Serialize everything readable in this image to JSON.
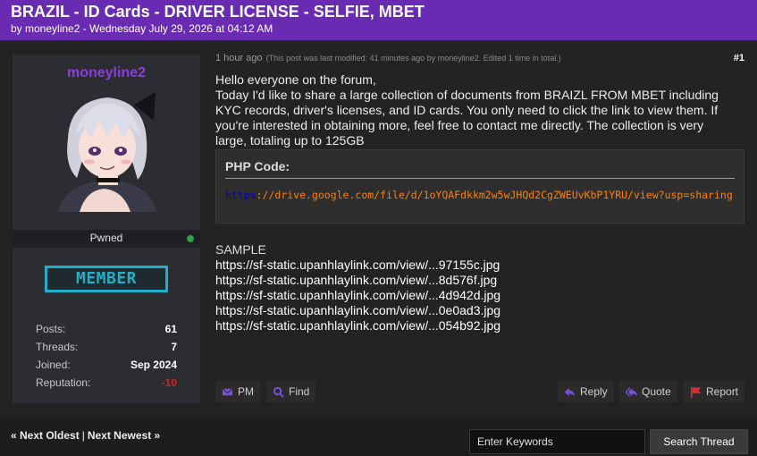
{
  "thread": {
    "title": "BRAZIL - ID Cards - DRIVER LICENSE - SELFIE, MBET",
    "meta": "by moneyline2 - Wednesday July 29, 2026 at 04:12 AM"
  },
  "author": {
    "username": "moneyline2",
    "status": "Pwned",
    "rank": "MEMBER",
    "stats": [
      {
        "label": "Posts:",
        "value": "61"
      },
      {
        "label": "Threads:",
        "value": "7"
      },
      {
        "label": "Joined:",
        "value": "Sep 2024"
      },
      {
        "label": "Reputation:",
        "value": "-10"
      }
    ]
  },
  "post": {
    "time": "1 hour ago",
    "edit_note": "(This post was last modified: 41 minutes ago by moneyline2. Edited 1 time in total.)",
    "number": "#1",
    "body": [
      "Hello everyone on the forum,",
      "Today I'd like to share a large collection of documents from BRAIZL FROM MBET including KYC records, driver's licenses, and ID cards. You only need to click the link to view them. If you're interested in obtaining more, feel free to contact me directly. The collection is very large, totaling up to 125GB"
    ],
    "code_title": "PHP Code:",
    "code_keyword": "https",
    "code_rest": "://drive.google.com/file/d/1oYQAFdkkm2w5wJHQd2CgZWEUvKbP1YRU/view?usp=sharing",
    "sample_label": "SAMPLE",
    "sample_links": [
      "https://sf-static.upanhlaylink.com/view/...97155c.jpg",
      "https://sf-static.upanhlaylink.com/view/...8d576f.jpg",
      "https://sf-static.upanhlaylink.com/view/...4d942d.jpg",
      "https://sf-static.upanhlaylink.com/view/...0e0ad3.jpg",
      "https://sf-static.upanhlaylink.com/view/...054b92.jpg"
    ],
    "buttons": {
      "pm": "PM",
      "find": "Find",
      "reply": "Reply",
      "quote": "Quote",
      "report": "Report"
    }
  },
  "footer": {
    "next_oldest": "« Next Oldest",
    "separator": "|",
    "next_newest": "Next Newest »",
    "search_placeholder": "Enter Keywords",
    "search_button": "Search Thread"
  },
  "colors": {
    "header": "#6a2bb3",
    "username": "#8a3fd8",
    "rank_badge": "#1fb1c9",
    "icon": "#7b4fe0",
    "report": "#d32f2f",
    "online": "#2ea043",
    "negative_rep": "#c62828"
  }
}
